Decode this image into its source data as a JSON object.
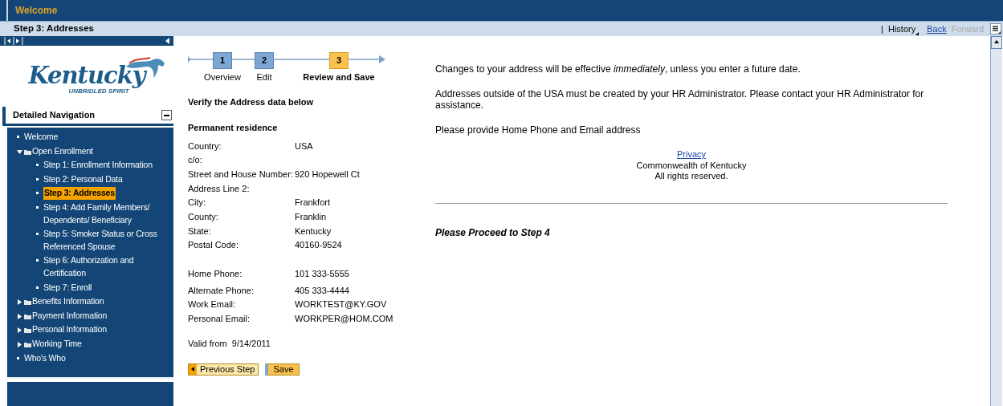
{
  "top_bar": {
    "title": "Welcome"
  },
  "page_header": {
    "title": "Step 3: Addresses",
    "separator": "|",
    "history": "History",
    "back": "Back",
    "forward": {
      "label": "Forward",
      "disabled": true
    }
  },
  "logo": {
    "name": "Kentucky",
    "tagline": "UNBRIDLED SPIRIT"
  },
  "navigation": {
    "title": "Detailed Navigation",
    "expanded": true,
    "items": [
      {
        "label": "Welcome",
        "kind": "page",
        "selected": false
      },
      {
        "label": "Open Enrollment",
        "kind": "folder",
        "expanded": true,
        "children": [
          {
            "label": "Step 1: Enrollment Information",
            "kind": "page",
            "selected": false
          },
          {
            "label": "Step 2: Personal Data",
            "kind": "page",
            "selected": false
          },
          {
            "label": "Step 3: Addresses",
            "kind": "page",
            "selected": true
          },
          {
            "label": "Step 4: Add Family Members/ Dependents/ Beneficiary",
            "kind": "page",
            "selected": false
          },
          {
            "label": "Step 5: Smoker Status or Cross Referenced Spouse",
            "kind": "page",
            "selected": false
          },
          {
            "label": "Step 6: Authorization and Certification",
            "kind": "page",
            "selected": false
          },
          {
            "label": "Step 7: Enroll",
            "kind": "page",
            "selected": false
          }
        ]
      },
      {
        "label": "Benefits Information",
        "kind": "folder",
        "expanded": false
      },
      {
        "label": "Payment Information",
        "kind": "folder",
        "expanded": false
      },
      {
        "label": "Personal Information",
        "kind": "folder",
        "expanded": false
      },
      {
        "label": "Working Time",
        "kind": "folder",
        "expanded": false
      },
      {
        "label": "Who's Who",
        "kind": "page",
        "selected": false
      }
    ]
  },
  "steps": [
    {
      "number": "1",
      "label": "Overview",
      "selected": false
    },
    {
      "number": "2",
      "label": "Edit",
      "selected": false
    },
    {
      "number": "3",
      "label": "Review and Save",
      "selected": true
    }
  ],
  "form": {
    "heading": "Verify the Address data below",
    "section": "Permanent residence",
    "address_fields": [
      {
        "label": "Country:",
        "value": "USA"
      },
      {
        "label": "c/o:"
      },
      {
        "label": "Street and House Number:",
        "value": "920 Hopewell Ct"
      },
      {
        "label": "Address Line 2:"
      },
      {
        "label": "City:",
        "value": "Frankfort"
      },
      {
        "label": "County:",
        "value": "Franklin"
      },
      {
        "label": "State:",
        "value": "Kentucky"
      },
      {
        "label": "Postal Code:",
        "value": "40160-9524"
      }
    ],
    "contact_fields": [
      {
        "label": "Home Phone:",
        "value": "101 333-5555"
      },
      {
        "label": "Alternate Phone:",
        "value": "405 333-4444"
      },
      {
        "label": "Work Email:",
        "value": "WORKTEST@KY.GOV"
      },
      {
        "label": "Personal Email:",
        "value": "WORKPER@HOM.COM"
      }
    ],
    "valid_from_label": "Valid from",
    "valid_from": "9/14/2011",
    "buttons": [
      {
        "label": "Previous Step",
        "kind": "back"
      },
      {
        "label": "Save",
        "kind": "primary"
      }
    ]
  },
  "info": {
    "paragraphs": [
      "Changes to your address will be effective *immediately*, unless you enter a future date.",
      "Addresses outside of the USA must be created by your HR Administrator.  Please contact your HR Administrator for assistance.",
      "Please provide Home Phone and Email address"
    ],
    "privacy_link": "Privacy",
    "footer": [
      "Commonwealth of Kentucky",
      "All rights reserved."
    ],
    "proceed": "Please Proceed to Step 4"
  }
}
